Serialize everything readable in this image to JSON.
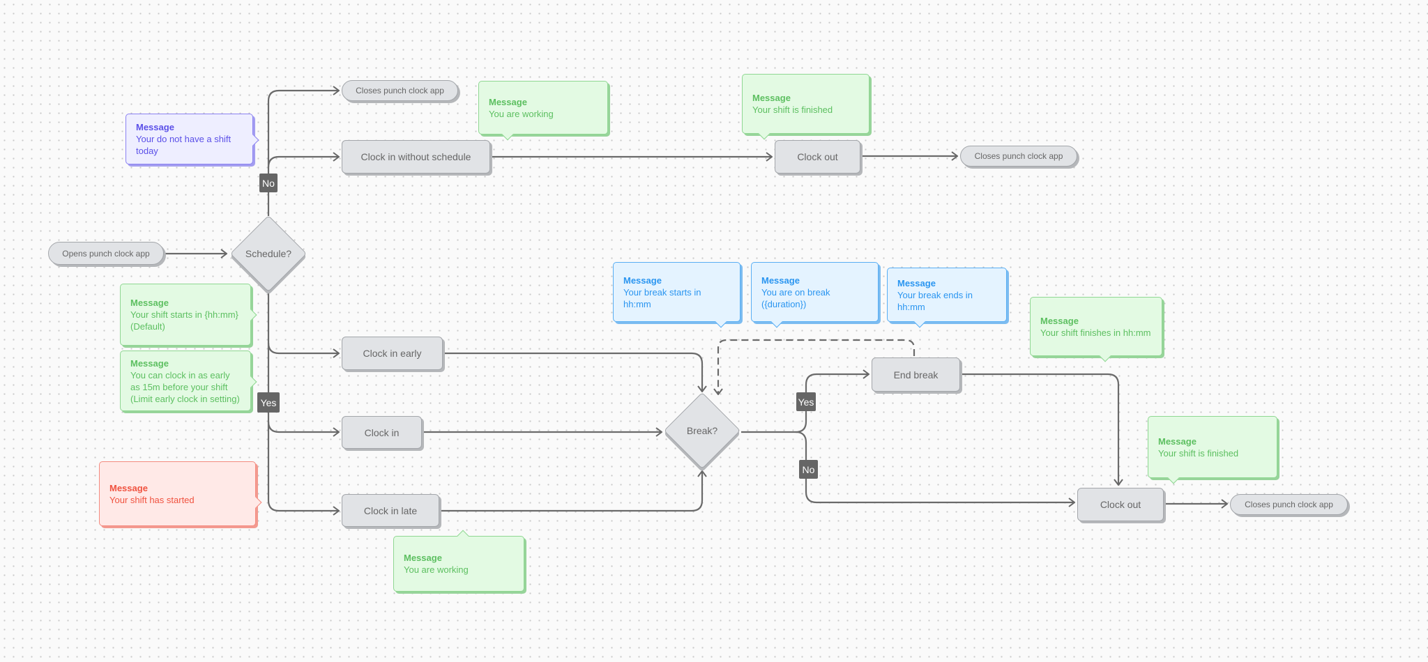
{
  "nodes": {
    "opens": "Opens punch clock app",
    "closes_top": "Closes punch clock app",
    "clock_in_without_schedule": "Clock in without schedule",
    "clock_out_top": "Clock out",
    "closes_top_right": "Closes punch clock app",
    "clock_in_early": "Clock in early",
    "clock_in": "Clock in",
    "clock_in_late": "Clock in late",
    "end_break": "End break",
    "clock_out_bottom": "Clock out",
    "closes_bottom": "Closes punch clock app"
  },
  "decisions": {
    "schedule": "Schedule?",
    "break": "Break?"
  },
  "labels": {
    "no_top": "No",
    "yes_left": "Yes",
    "yes_right": "Yes",
    "no_right": "No"
  },
  "messages": [
    {
      "title": "Message",
      "lines": [
        "Your do not have a shift today"
      ],
      "color": "#5b50e8"
    },
    {
      "title": "Message",
      "lines": [
        "You are working"
      ],
      "color": "#5cbf60"
    },
    {
      "title": "Message",
      "lines": [
        "Your shift is finished"
      ],
      "color": "#5cbf60"
    },
    {
      "title": "Message",
      "lines": [
        "Your shift starts in {hh:mm}",
        "(Default)"
      ],
      "color": "#5cbf60"
    },
    {
      "title": "Message",
      "lines": [
        "You can clock in as early",
        "as 15m before your shift",
        "(Limit early clock in setting)"
      ],
      "color": "#5cbf60"
    },
    {
      "title": "Message",
      "lines": [
        "Your shift has started"
      ],
      "color": "#f0523f"
    },
    {
      "title": "Message",
      "lines": [
        "You are working"
      ],
      "color": "#5cbf60"
    },
    {
      "title": "Message",
      "lines": [
        "Your break starts in hh:mm"
      ],
      "color": "#2a95f0"
    },
    {
      "title": "Message",
      "lines": [
        "You are on break ({duration})"
      ],
      "color": "#2a95f0"
    },
    {
      "title": "Message",
      "lines": [
        "Your break ends in hh:mm"
      ],
      "color": "#2a95f0"
    },
    {
      "title": "Message",
      "lines": [
        "Your shift finishes in hh:mm"
      ],
      "color": "#5cbf60"
    },
    {
      "title": "Message",
      "lines": [
        "Your shift is finished"
      ],
      "color": "#5cbf60"
    }
  ]
}
